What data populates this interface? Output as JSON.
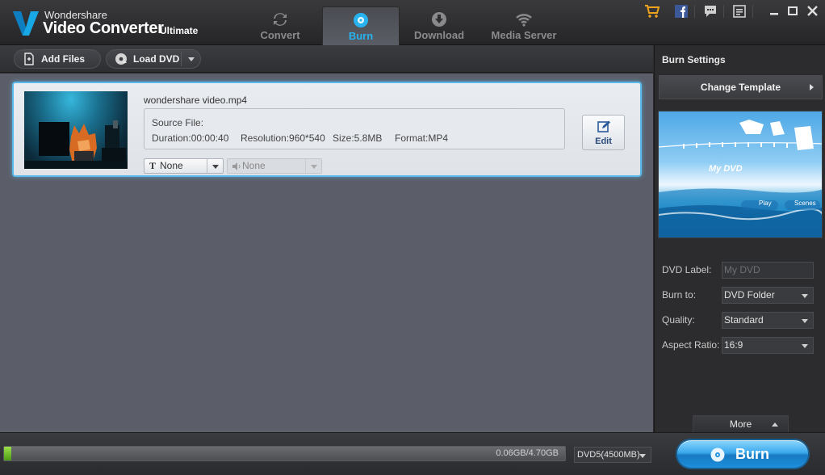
{
  "brand": {
    "line1": "Wondershare",
    "line2": "Video Converter",
    "edition": "Ultimate"
  },
  "tabs": [
    {
      "label": "Convert",
      "icon": "convert-icon"
    },
    {
      "label": "Burn",
      "icon": "burn-icon",
      "active": true
    },
    {
      "label": "Download",
      "icon": "download-icon"
    },
    {
      "label": "Media Server",
      "icon": "wifi-icon"
    }
  ],
  "window_icons": [
    "cart-icon",
    "facebook-icon",
    "chat-icon",
    "menu-icon",
    "minimize-icon",
    "maximize-icon",
    "close-icon"
  ],
  "toolbar": {
    "add_files": "Add Files",
    "load_dvd": "Load DVD"
  },
  "item": {
    "filename": "wondershare video.mp4",
    "source_label": "Source File:",
    "duration": "Duration:00:00:40",
    "resolution": "Resolution:960*540",
    "size": "Size:5.8MB",
    "format": "Format:MP4",
    "edit_label": "Edit",
    "subtitle": "None",
    "audio": "None"
  },
  "burn_settings": {
    "title": "Burn Settings",
    "change_template": "Change Template",
    "preview": {
      "title": "My DVD",
      "play": "Play",
      "scenes": "Scenes"
    },
    "dvd_label": {
      "label": "DVD Label:",
      "placeholder": "My DVD"
    },
    "burn_to": {
      "label": "Burn to:",
      "value": "DVD Folder"
    },
    "quality": {
      "label": "Quality:",
      "value": "Standard"
    },
    "aspect": {
      "label": "Aspect Ratio:",
      "value": "16:9"
    },
    "more": "More"
  },
  "bottom": {
    "progress_fraction": 0.013,
    "usage": "0.06GB/4.70GB",
    "disc_type": "DVD5(4500MB)",
    "burn": "Burn"
  },
  "colors": {
    "accent": "#27b3f0",
    "progress": "#7cc22d",
    "burn_button": "#1d8fdb"
  }
}
